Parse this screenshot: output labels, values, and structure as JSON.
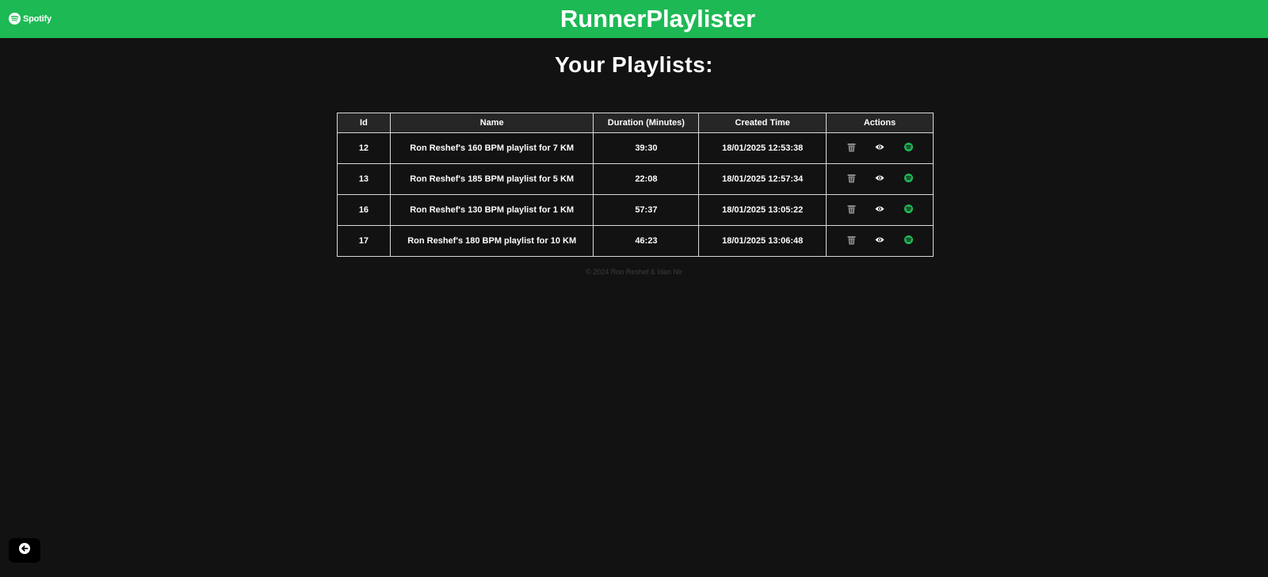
{
  "header": {
    "logo_text": "Spotify",
    "title": "RunnerPlaylister",
    "brand_color": "#1db954"
  },
  "page": {
    "heading": "Your Playlists:"
  },
  "table": {
    "columns": [
      "Id",
      "Name",
      "Duration (Minutes)",
      "Created Time",
      "Actions"
    ],
    "rows": [
      {
        "id": "12",
        "name": "Ron Reshef's 160 BPM playlist for 7 KM",
        "duration": "39:30",
        "created": "18/01/2025 12:53:38"
      },
      {
        "id": "13",
        "name": "Ron Reshef's 185 BPM playlist for 5 KM",
        "duration": "22:08",
        "created": "18/01/2025 12:57:34"
      },
      {
        "id": "16",
        "name": "Ron Reshef's 130 BPM playlist for 1 KM",
        "duration": "57:37",
        "created": "18/01/2025 13:05:22"
      },
      {
        "id": "17",
        "name": "Ron Reshef's 180 BPM playlist for 10 KM",
        "duration": "46:23",
        "created": "18/01/2025 13:06:48"
      }
    ],
    "action_icons": [
      "trash-icon",
      "eye-icon",
      "spotify-icon"
    ]
  },
  "footer": {
    "text": "© 2024 Ron Reshef & Idan Nir"
  },
  "back_button": {
    "icon": "arrow-left-icon"
  }
}
